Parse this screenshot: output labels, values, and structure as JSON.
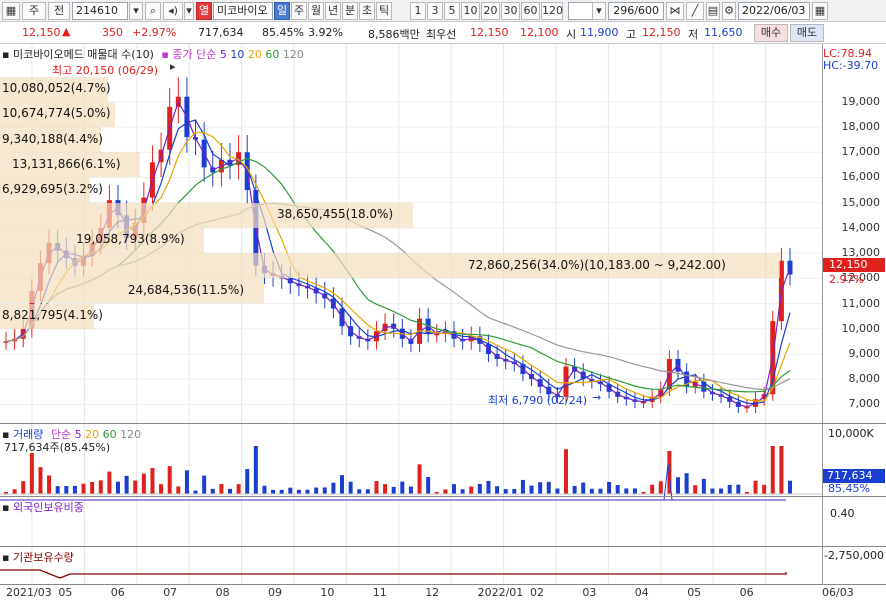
{
  "toolbar": {
    "market_select": "주",
    "chart_type": "전",
    "code": "214610",
    "stock_name": "미코바이오",
    "period_buttons": [
      "일",
      "주",
      "월",
      "년",
      "분",
      "초",
      "틱"
    ],
    "interval_buttons": [
      "1",
      "3",
      "5",
      "10",
      "20",
      "30",
      "60",
      "120"
    ],
    "range": "296/600",
    "date": "2022/06/03",
    "realtime_label": "열"
  },
  "pricebar": {
    "price": "12,150",
    "change_arrow": "▲",
    "change": "350",
    "change_pct": "+2.97%",
    "volume": "717,634",
    "volume_pct": "85.45%",
    "turnover": "3.92%",
    "amount": "8,586백만",
    "best_label": "최우선",
    "best_ask": "12,150",
    "best_bid": "12,100",
    "open_label": "시",
    "open": "11,900",
    "high_label": "고",
    "high": "12,150",
    "low_label": "저",
    "low": "11,650",
    "buy_button": "매수",
    "sell_button": "매도"
  },
  "price_panel": {
    "title": "미코바이오메드 매물대 수(10)",
    "ma_label": "종가 단순",
    "ma_periods": [
      {
        "label": "5",
        "color": "#7a1fc8"
      },
      {
        "label": "10",
        "color": "#1a3fd0"
      },
      {
        "label": "20",
        "color": "#e6a600"
      },
      {
        "label": "60",
        "color": "#2f9a3a"
      },
      {
        "label": "120",
        "color": "#888888"
      }
    ],
    "lc": "LC:78.94",
    "hc": "HC:-39.70",
    "high_note": "최고 20,150 (06/29)",
    "low_note": "최저 6,790 (02/24)",
    "current_price_tag": "12,150",
    "current_pct_tag": "2.97%"
  },
  "volume_profile": [
    {
      "price": 19500,
      "label": "10,080,052(4.7%)"
    },
    {
      "price": 18500,
      "label": "10,674,774(5.0%)"
    },
    {
      "price": 17500,
      "label": "9,340,188(4.4%)"
    },
    {
      "price": 16500,
      "label": "13,131,866(6.1%)"
    },
    {
      "price": 15500,
      "label": "6,929,695(3.2%)"
    },
    {
      "price": 14500,
      "label": "38,650,455(18.0%)"
    },
    {
      "price": 13500,
      "label": "19,058,793(8.9%)"
    },
    {
      "price": 12500,
      "label": "72,860,256(34.0%)(10,183.00 ~ 9,242.00)"
    },
    {
      "price": 11500,
      "label": "24,684,536(11.5%)"
    },
    {
      "price": 10500,
      "label": "8,821,795(4.1%)"
    }
  ],
  "volume_panel": {
    "title": "거래량",
    "ma_label": "단순",
    "ma_periods": [
      {
        "label": "5",
        "color": "#7a1fc8"
      },
      {
        "label": "20",
        "color": "#e6a600"
      },
      {
        "label": "60",
        "color": "#2f9a3a"
      },
      {
        "label": "120",
        "color": "#888888"
      }
    ],
    "value_line": "717,634주(85.45%)",
    "tag_value": "717,634",
    "tag_pct": "85.45%",
    "axis_label": "10,000K"
  },
  "foreign_panel": {
    "title": "외국인보유비중",
    "axis_label": "0.40"
  },
  "institution_panel": {
    "title": "기관보유수량",
    "axis_label": "-2,750,000"
  },
  "chart_data": {
    "type": "candlestick",
    "y_ticks": [
      19000,
      18000,
      17000,
      16000,
      15000,
      14000,
      13000,
      12000,
      11000,
      10000,
      9000,
      8000,
      7000
    ],
    "ylim": [
      6300,
      20500
    ],
    "x_labels": [
      "2021/03",
      "05",
      "06",
      "07",
      "08",
      "09",
      "10",
      "11",
      "12",
      "2022/01",
      "02",
      "03",
      "04",
      "05",
      "06",
      "06/03"
    ],
    "close_series": [
      9500,
      9600,
      10000,
      11500,
      12600,
      13400,
      13100,
      12800,
      12500,
      12900,
      13400,
      14000,
      15100,
      14500,
      13600,
      14200,
      15200,
      16600,
      17100,
      18800,
      19200,
      17600,
      17500,
      16400,
      16200,
      16700,
      16500,
      17000,
      15500,
      12500,
      12200,
      12100,
      12000,
      11800,
      11700,
      11600,
      11400,
      11200,
      10800,
      10100,
      9700,
      9600,
      9500,
      9900,
      10200,
      10000,
      9600,
      9400,
      10400,
      9800,
      9800,
      9900,
      9600,
      9500,
      9700,
      9400,
      9000,
      8800,
      8700,
      8600,
      8200,
      8000,
      7700,
      7400,
      7300,
      8500,
      8300,
      8000,
      7900,
      7800,
      7500,
      7300,
      7200,
      7100,
      7100,
      7300,
      7600,
      8800,
      8300,
      7700,
      7900,
      7500,
      7400,
      7300,
      7100,
      6900,
      6900,
      7200,
      7400,
      10300,
      12700,
      12150
    ]
  }
}
